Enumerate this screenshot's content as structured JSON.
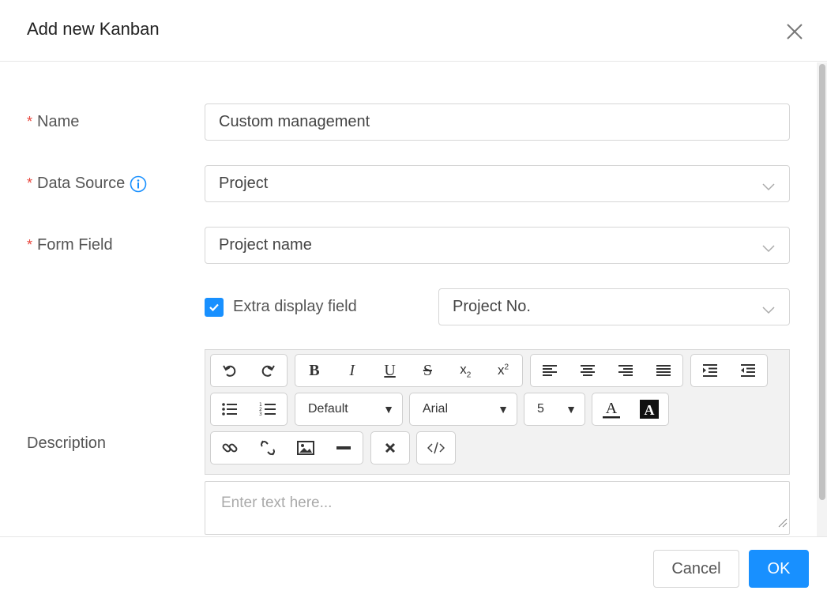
{
  "dialog": {
    "title": "Add new Kanban"
  },
  "form": {
    "name_label": "Name",
    "name_value": "Custom management",
    "data_source_label": "Data Source",
    "data_source_value": "Project",
    "form_field_label": "Form Field",
    "form_field_value": "Project name",
    "extra_display_label": "Extra display field",
    "extra_display_checked": true,
    "extra_display_value": "Project No.",
    "description_label": "Description",
    "description_placeholder": "Enter text here..."
  },
  "editor": {
    "format_select": "Default",
    "font_select": "Arial",
    "size_select": "5",
    "icons": [
      "undo-icon",
      "redo-icon",
      "bold-icon",
      "italic-icon",
      "underline-icon",
      "strikethrough-icon",
      "subscript-icon",
      "superscript-icon",
      "align-left-icon",
      "align-center-icon",
      "align-right-icon",
      "align-justify-icon",
      "indent-icon",
      "outdent-icon",
      "bullet-list-icon",
      "numbered-list-icon",
      "font-color-icon",
      "highlight-color-icon",
      "link-icon",
      "unlink-icon",
      "image-icon",
      "horizontal-rule-icon",
      "clear-format-icon",
      "source-code-icon"
    ]
  },
  "footer": {
    "cancel_label": "Cancel",
    "ok_label": "OK"
  },
  "colors": {
    "primary": "#1890ff",
    "required": "#e8453c"
  }
}
